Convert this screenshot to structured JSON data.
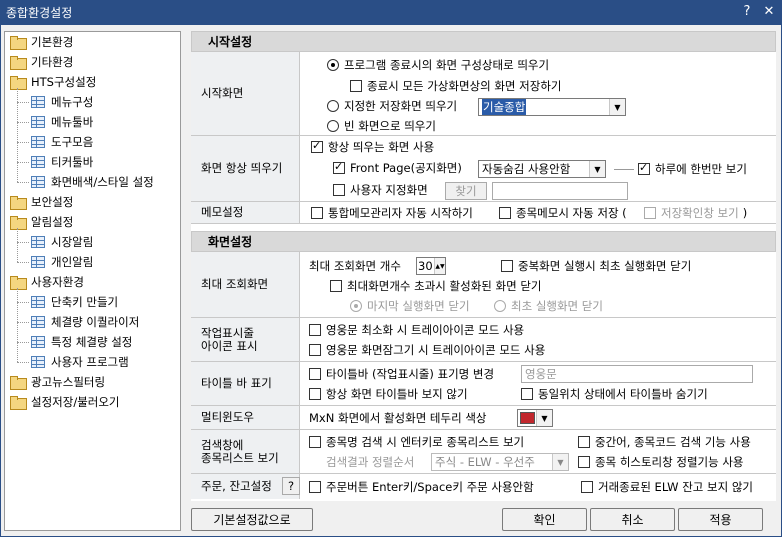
{
  "window": {
    "title": "종합환경설정",
    "help": "?",
    "close": "✕"
  },
  "tree": [
    {
      "label": "기본환경",
      "icon": "folder-icon",
      "level": 0
    },
    {
      "label": "기타환경",
      "icon": "folder-icon",
      "level": 0
    },
    {
      "label": "HTS구성설정",
      "icon": "folder-open-icon",
      "level": 0
    },
    {
      "label": "메뉴구성",
      "icon": "grid-icon",
      "level": 1
    },
    {
      "label": "메뉴툴바",
      "icon": "grid-icon",
      "level": 1
    },
    {
      "label": "도구모음",
      "icon": "grid-icon",
      "level": 1
    },
    {
      "label": "티커툴바",
      "icon": "grid-icon",
      "level": 1
    },
    {
      "label": "화면배색/스타일 설정",
      "icon": "grid-icon",
      "level": 1
    },
    {
      "label": "보안설정",
      "icon": "folder-icon",
      "level": 0
    },
    {
      "label": "알림설정",
      "icon": "folder-open-icon",
      "level": 0
    },
    {
      "label": "시장알림",
      "icon": "grid-icon",
      "level": 1
    },
    {
      "label": "개인알림",
      "icon": "grid-icon",
      "level": 1
    },
    {
      "label": "사용자환경",
      "icon": "folder-open-icon",
      "level": 0
    },
    {
      "label": "단축키 만들기",
      "icon": "grid-icon",
      "level": 1
    },
    {
      "label": "체결량 이퀄라이저",
      "icon": "grid-icon",
      "level": 1
    },
    {
      "label": "특정 체결량 설정",
      "icon": "grid-icon",
      "level": 1
    },
    {
      "label": "사용자 프로그램",
      "icon": "grid-icon",
      "level": 1
    },
    {
      "label": "광고뉴스필터링",
      "icon": "folder-icon",
      "level": 0
    },
    {
      "label": "설정저장/불러오기",
      "icon": "folder-icon",
      "level": 0
    }
  ],
  "sections": {
    "startup": "시작설정",
    "screen": "화면설정"
  },
  "startup": {
    "label": "시작화면",
    "opt1": "프로그램 종료시의 화면 구성상태로 띄우기",
    "opt1_sub": "종료시 모든 가상화면상의 화면 저장하기",
    "opt2": "지정한 저장화면 띄우기",
    "opt2_value": "기술종합",
    "opt3": "빈 화면으로 띄우기"
  },
  "always_on_top": {
    "label": "화면 항상 띄우기",
    "use": "항상 띄우는 화면 사용",
    "frontpage": "Front Page(공지화면)",
    "frontpage_value": "자동숨김 사용안함",
    "once_a_day": "하루에 한번만 보기",
    "user_screen": "사용자 지정화면",
    "find_button": "찾기"
  },
  "memo": {
    "label": "메모설정",
    "auto_start": "통합메모관리자 자동 시작하기",
    "auto_save": "종목메모시 자동 저장 (",
    "view_saved": "저장확인창 보기",
    "close_paren": ")"
  },
  "max_screens": {
    "label": "최대 조회화면",
    "count_label": "최대 조회화면 개수",
    "count_value": "30",
    "dup_close": "중복화면 실행시 최초 실행화면 닫기",
    "exceed_close": "최대화면개수 초과시 활성화된 화면 닫기",
    "last_exec": "마지막 실행화면 닫기",
    "first_exec": "최초 실행화면 닫기"
  },
  "tray": {
    "label": "작업표시줄\n아이콘 표시",
    "minimize": "영웅문 최소화 시 트레이아이콘 모드 사용",
    "lock": "영웅문 화면잠그기 시 트레이아이콘 모드 사용"
  },
  "titlebar_opts": {
    "label": "타이틀 바 표기",
    "rename": "타이틀바 (작업표시줄) 표기명 변경",
    "rename_value": "영웅문",
    "hide_always": "항상 화면 타이틀바 보지 않기",
    "hide_docked": "동일위치 상태에서 타이틀바 숨기기"
  },
  "multiwindow": {
    "label": "멀티윈도우",
    "border_color": "MxN 화면에서 활성화면 테두리 색상",
    "color": "#c1272d"
  },
  "search": {
    "label": "검색창에\n종목리스트 보기",
    "enter_list": "종목명 검색 시 엔터키로 종목리스트 보기",
    "middle_search": "중간어, 종목코드 검색 기능 사용",
    "sort_label": "검색결과 정렬순서",
    "sort_value": "주식 - ELW - 우선주",
    "history_sort": "종목 히스토리창 정렬기능 사용"
  },
  "order": {
    "label": "주문, 잔고설정",
    "help": "?",
    "enter_space": "주문버튼 Enter키/Space키 주문 사용안함",
    "hide_expired": "거래종료된 ELW 잔고 보지 않기"
  },
  "buttons": {
    "defaults": "기본설정값으로",
    "ok": "확인",
    "cancel": "취소",
    "apply": "적용"
  }
}
